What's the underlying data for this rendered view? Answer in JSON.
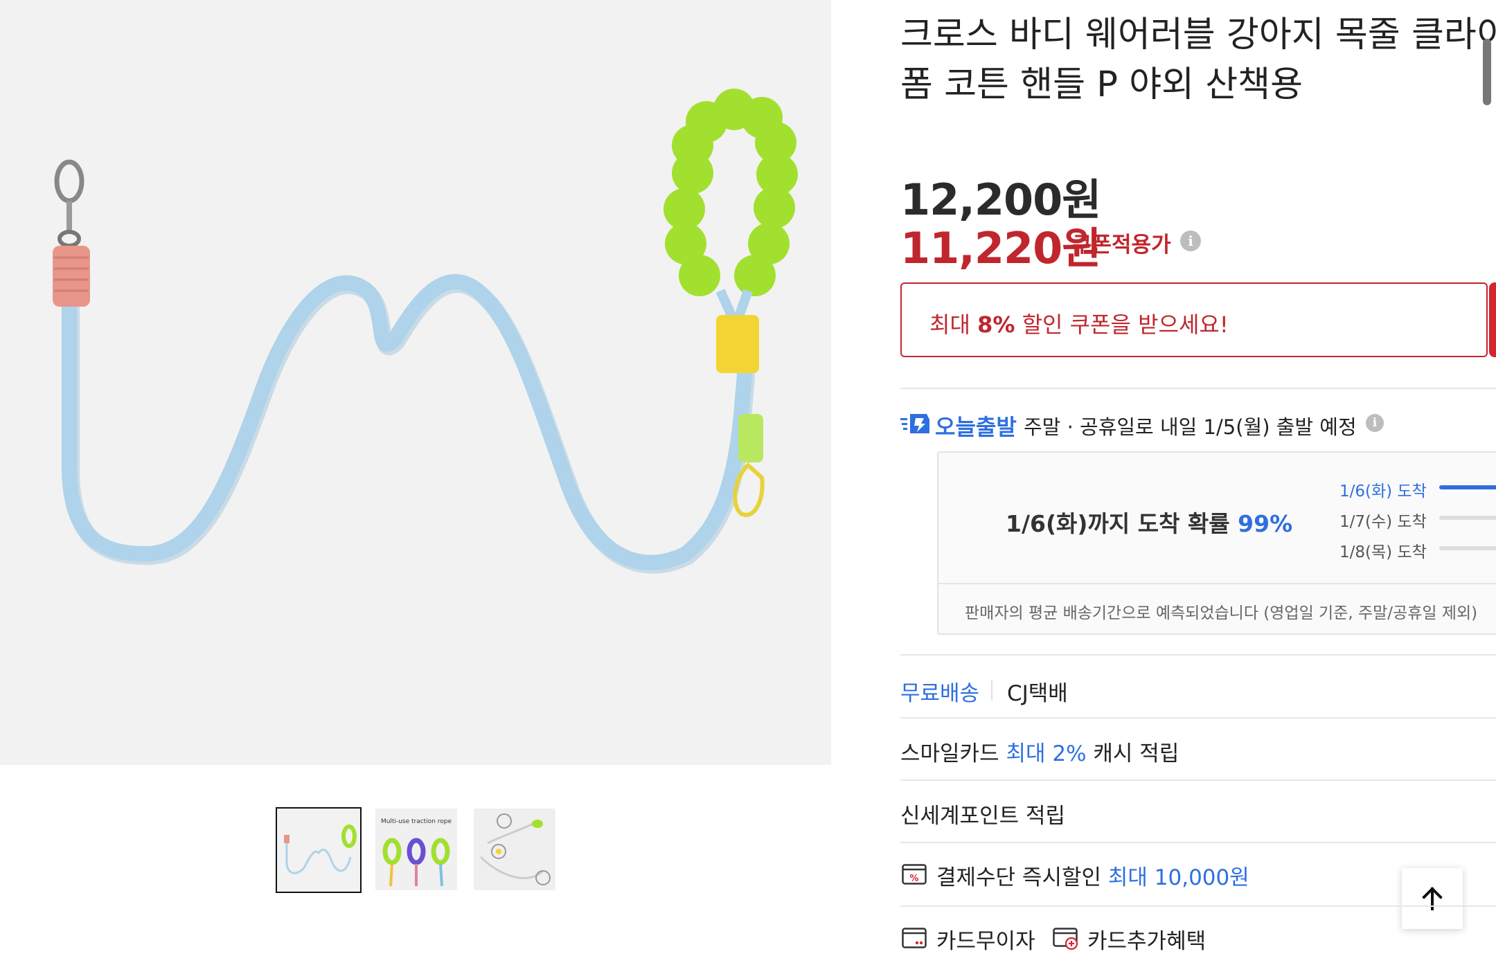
{
  "product": {
    "title_line1": "크로스 바디 웨어러블 강아지 목줄 클라이",
    "title_line2": "폼 코튼 핸들 P 야외 산책용"
  },
  "price": {
    "original": "12,200원",
    "coupon_price": "11,220원",
    "coupon_label": "쿠폰적용가"
  },
  "coupon_banner": {
    "prefix": "최대 ",
    "percent": "8%",
    "suffix": " 할인 쿠폰을 받으세요!"
  },
  "shipping": {
    "today_label": "오늘출발",
    "description": "주말 · 공휴일로 내일 1/5(월) 출발 예정",
    "arrival_main": "1/6(화)까지 도착 확률 ",
    "arrival_pct": "99%",
    "arrival_rows": [
      {
        "label": "1/6(화) 도착",
        "probability": 0.99
      },
      {
        "label": "1/7(수) 도착",
        "probability": 0.01
      },
      {
        "label": "1/8(목) 도착",
        "probability": 0.0
      }
    ],
    "note": "판매자의 평균 배송기간으로 예측되었습니다 (영업일 기준, 주말/공휴일 제외)",
    "free_shipping": "무료배송",
    "courier": "CJ택배"
  },
  "benefits": {
    "smile_card_prefix": "스마일카드 ",
    "smile_card_highlight": "최대 2%",
    "smile_card_suffix": " 캐시 적립",
    "shinsegae": "신세계포인트 적립",
    "pay_prefix": "결제수단 즉시할인 ",
    "pay_highlight": "최대 10,000원",
    "card_no_interest": "카드무이자",
    "card_extra": "카드추가혜택"
  },
  "thumbnails": {
    "thumb2_caption": "Multi-use traction rope"
  },
  "icons": {
    "info": "info-icon",
    "today_ship": "fast-delivery-icon",
    "pay": "percent-card-icon",
    "card": "card-icon",
    "card_plus": "card-plus-icon",
    "top": "arrow-up-icon"
  },
  "colors": {
    "accent_red": "#c0262d",
    "accent_blue": "#2e6fe0",
    "handle_green": "#9be02a",
    "rope_blue": "#aed3ea"
  }
}
